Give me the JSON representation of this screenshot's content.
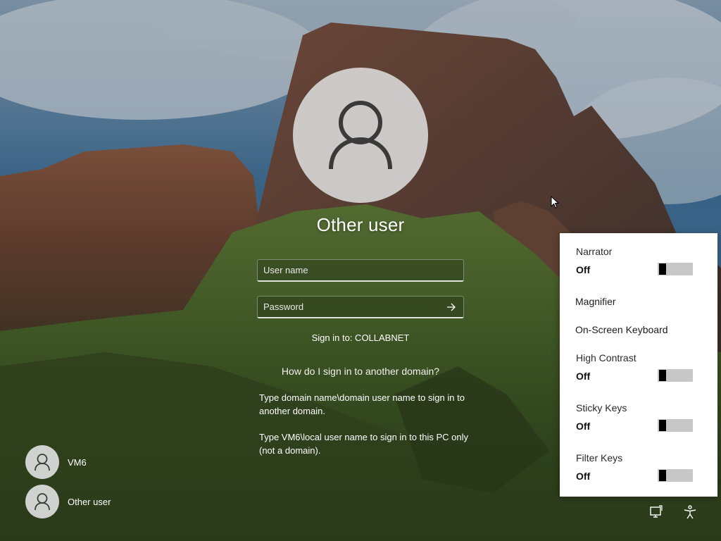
{
  "login": {
    "title": "Other user",
    "username_placeholder": "User name",
    "password_placeholder": "Password",
    "sign_in_to": "Sign in to: COLLABNET",
    "help_link": "How do I sign in to another domain?",
    "help_p1": "Type domain name\\domain user name to sign in to another domain.",
    "help_p2": "Type VM6\\local user name to sign in to this PC only (not a domain)."
  },
  "users": [
    {
      "name": "VM6"
    },
    {
      "name": "Other user"
    }
  ],
  "accessibility": {
    "narrator": {
      "label": "Narrator",
      "state": "Off"
    },
    "magnifier": {
      "label": "Magnifier"
    },
    "osk": {
      "label": "On-Screen Keyboard"
    },
    "high_contrast": {
      "label": "High Contrast",
      "state": "Off"
    },
    "sticky_keys": {
      "label": "Sticky Keys",
      "state": "Off"
    },
    "filter_keys": {
      "label": "Filter Keys",
      "state": "Off"
    }
  },
  "icons": {
    "avatar": "person-icon",
    "submit": "arrow-right-icon",
    "network": "network-icon",
    "accessibility": "accessibility-icon"
  },
  "colors": {
    "flyout_bg": "#ffffff",
    "toggle_off": "#c7c7c7"
  }
}
